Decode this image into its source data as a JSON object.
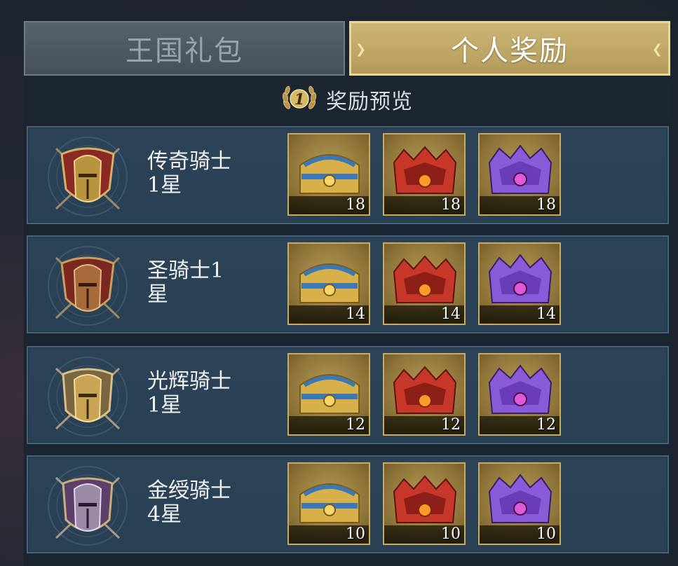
{
  "tabs": {
    "kingdom_label": "王国礼包",
    "personal_label": "个人奖励"
  },
  "header": {
    "badge_number": "1",
    "title": "奖励预览"
  },
  "rows": [
    {
      "rank": "传奇骑士\n1星",
      "emblem": "red-knight-helmet-shield-icon",
      "rewards": [
        {
          "chest": "gold-blue-chest-icon",
          "count": "18"
        },
        {
          "chest": "red-demon-chest-icon",
          "count": "18"
        },
        {
          "chest": "purple-crystal-chest-icon",
          "count": "18"
        }
      ]
    },
    {
      "rank": "圣骑士1\n星",
      "emblem": "red-knight-helmet-shield-icon",
      "rewards": [
        {
          "chest": "gold-blue-chest-icon",
          "count": "14"
        },
        {
          "chest": "red-demon-chest-icon",
          "count": "14"
        },
        {
          "chest": "purple-crystal-chest-icon",
          "count": "14"
        }
      ]
    },
    {
      "rank": "光辉骑士\n1星",
      "emblem": "gold-knight-helmet-shield-icon",
      "rewards": [
        {
          "chest": "gold-blue-chest-icon",
          "count": "12"
        },
        {
          "chest": "red-demon-chest-icon",
          "count": "12"
        },
        {
          "chest": "purple-crystal-chest-icon",
          "count": "12"
        }
      ]
    },
    {
      "rank": "金绶骑士\n4星",
      "emblem": "purple-knight-helmet-shield-icon",
      "rewards": [
        {
          "chest": "gold-blue-chest-icon",
          "count": "10"
        },
        {
          "chest": "red-demon-chest-icon",
          "count": "10"
        },
        {
          "chest": "purple-crystal-chest-icon",
          "count": "10"
        }
      ]
    }
  ],
  "colors": {
    "emblem_red": "#8b2a22",
    "emblem_gold": "#7a6640",
    "emblem_purple": "#5c3f6a",
    "chest_gold": "#d8b04a",
    "chest_red": "#c8382a",
    "chest_purple": "#8a5bd8",
    "accent_gold": "#c8ab5e"
  }
}
